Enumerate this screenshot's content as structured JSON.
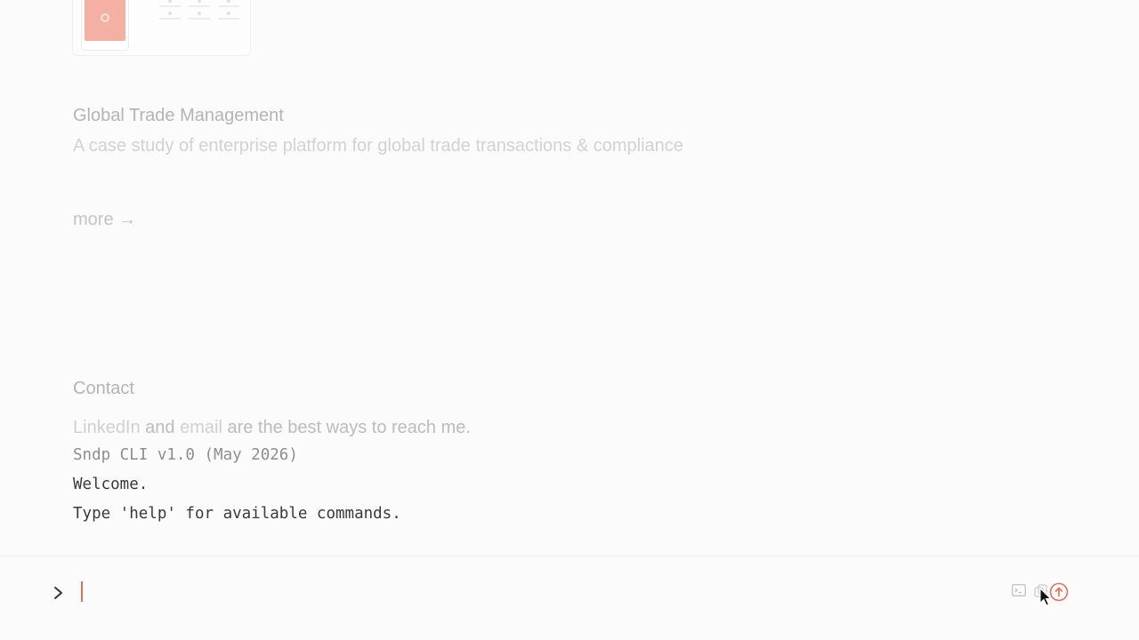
{
  "project": {
    "title": "Global Trade Management",
    "subtitle": "A case study of enterprise platform for global trade transactions & compliance",
    "more_link": "more →"
  },
  "contact": {
    "heading": "Contact",
    "linkedin_link": "LinkedIn",
    "and_text": " and ",
    "email_link": "email",
    "tail_text": " are the best ways to reach me."
  },
  "cli": {
    "version_line": "Sndp CLI v1.0 (May 2026)",
    "welcome_line": "Welcome.",
    "help_line": "Type 'help' for available commands.",
    "input_value": "",
    "input_placeholder": ""
  },
  "icons": {
    "prompt": "chevron-right-icon",
    "terminal": "terminal-icon",
    "copy": "copy-icon",
    "upload": "arrow-up-circle-icon"
  },
  "colors": {
    "accent": "#e0705a",
    "thumbnail": "#f4b0a2"
  }
}
